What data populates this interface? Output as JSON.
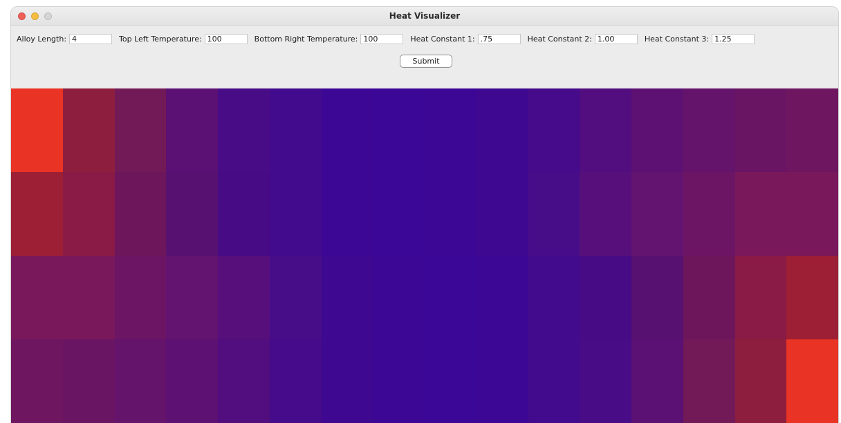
{
  "window": {
    "title": "Heat Visualizer"
  },
  "traffic_lights": {
    "close": "#ee5f57",
    "minimize": "#f5be3f",
    "zoom": "#d6d6d6"
  },
  "form": {
    "alloy_length_label": "Alloy Length:",
    "alloy_length_value": "4",
    "top_left_temp_label": "Top Left Temperature:",
    "top_left_temp_value": "100",
    "bottom_right_temp_label": "Bottom Right Temperature:",
    "bottom_right_temp_value": "100",
    "heat_constant_1_label": "Heat Constant 1:",
    "heat_constant_1_value": ".75",
    "heat_constant_2_label": "Heat Constant 2:",
    "heat_constant_2_value": "1.00",
    "heat_constant_3_label": "Heat Constant 3:",
    "heat_constant_3_value": "1.25",
    "submit_label": "Submit"
  },
  "heatmap": {
    "rows": 4,
    "cols": 16,
    "colors": [
      [
        "#e93325",
        "#8e1e3e",
        "#721a57",
        "#5a1173",
        "#480c86",
        "#420b8e",
        "#3c0795",
        "#3b0797",
        "#3c0795",
        "#3f0891",
        "#450b8a",
        "#520d7f",
        "#5d1173",
        "#64146a",
        "#6a1564",
        "#6e1660"
      ],
      [
        "#9c1f35",
        "#8a1a46",
        "#6d165c",
        "#571271",
        "#470b86",
        "#420b8e",
        "#3c0795",
        "#3b0797",
        "#3c0795",
        "#3f0891",
        "#470c88",
        "#560f7b",
        "#621470",
        "#6d1565",
        "#7a185c",
        "#7a185c"
      ],
      [
        "#7a185c",
        "#7a185c",
        "#6d1565",
        "#621470",
        "#560f7b",
        "#470c88",
        "#3f0891",
        "#3c0795",
        "#3b0797",
        "#3c0795",
        "#420b8e",
        "#470b86",
        "#571271",
        "#6d165c",
        "#8a1a46",
        "#9c1f35"
      ],
      [
        "#6e1660",
        "#6a1564",
        "#64146a",
        "#5d1173",
        "#520d7f",
        "#450b8a",
        "#3f0891",
        "#3c0795",
        "#3b0797",
        "#3c0795",
        "#420b8e",
        "#480c86",
        "#5a1173",
        "#721a57",
        "#8e1e3e",
        "#e93325"
      ]
    ]
  }
}
